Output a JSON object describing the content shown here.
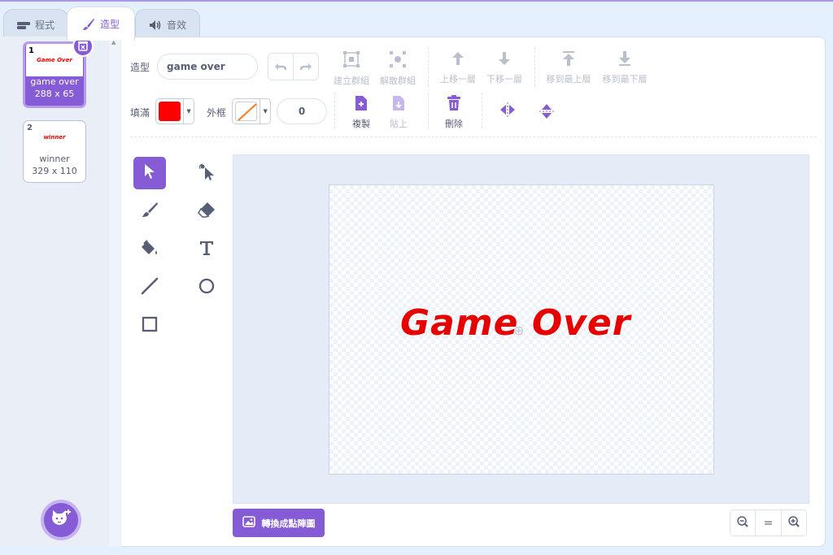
{
  "tabs": [
    {
      "label": "程式",
      "icon": "code-icon"
    },
    {
      "label": "造型",
      "icon": "brush-icon"
    },
    {
      "label": "音效",
      "icon": "speaker-icon"
    }
  ],
  "costumes": [
    {
      "number": "1",
      "name": "game over",
      "size": "288 x 65",
      "thumb_text": "Game Over",
      "selected": true
    },
    {
      "number": "2",
      "name": "winner",
      "size": "329 x 110",
      "thumb_text": "winner",
      "selected": false
    }
  ],
  "toolbar": {
    "costume_label": "造型",
    "costume_name": "game over",
    "group": "建立群組",
    "ungroup": "解散群組",
    "forward": "上移一層",
    "backward": "下移一層",
    "front": "移到最上層",
    "back": "移到最下層",
    "fill_label": "填滿",
    "fill_color": "#ff0000",
    "outline_label": "外框",
    "stroke_width": "0",
    "copy": "複製",
    "paste": "貼上",
    "delete": "刪除"
  },
  "tools": [
    "select-tool",
    "reshape-tool",
    "brush-tool",
    "eraser-tool",
    "fill-tool",
    "text-tool",
    "line-tool",
    "circle-tool",
    "rectangle-tool"
  ],
  "canvas": {
    "costume_text": "Game Over",
    "text_color": "#e60000"
  },
  "footer": {
    "convert_bitmap": "轉換成點陣圖",
    "zoom_reset": "="
  },
  "colors": {
    "accent": "#855cd6",
    "background": "#e5f0ff"
  }
}
